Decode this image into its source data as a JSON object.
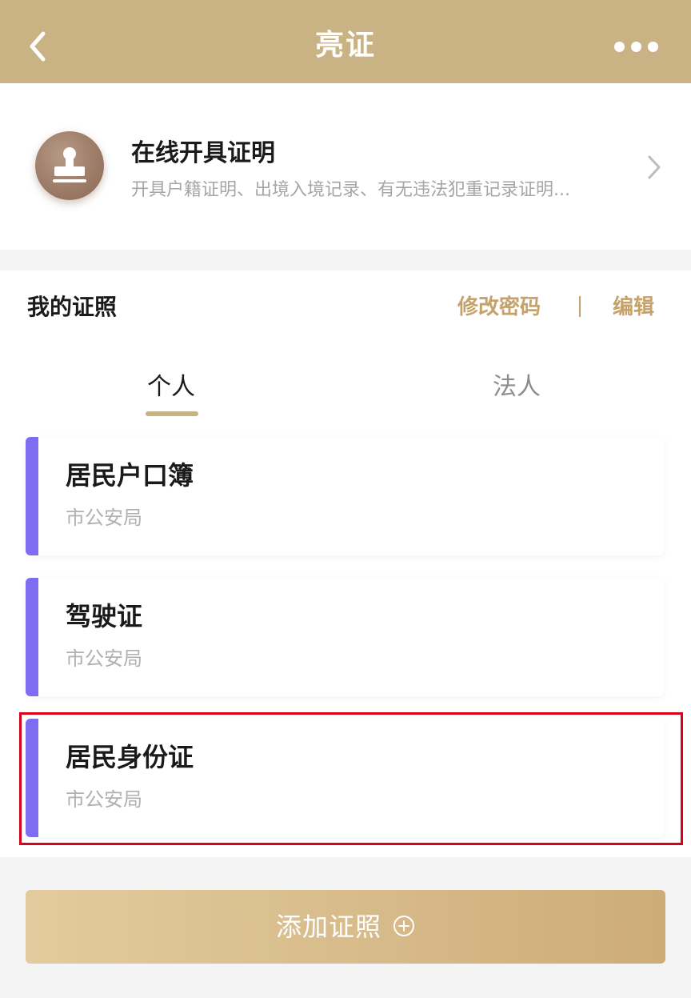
{
  "header": {
    "title": "亮证"
  },
  "service": {
    "title": "在线开具证明",
    "description": "开具户籍证明、出境入境记录、有无违法犯重记录证明..."
  },
  "certificates": {
    "section_title": "我的证照",
    "change_password": "修改密码",
    "edit": "编辑",
    "tabs": [
      {
        "label": "个人",
        "active": true
      },
      {
        "label": "法人",
        "active": false
      }
    ],
    "items": [
      {
        "title": "居民户口簿",
        "issuer": "市公安局"
      },
      {
        "title": "驾驶证",
        "issuer": "市公安局"
      },
      {
        "title": "居民身份证",
        "issuer": "市公安局",
        "highlighted": true
      }
    ],
    "accent_color": "#7f6cf2"
  },
  "add_button": {
    "label": "添加证照",
    "icon": "plus-circle-icon"
  },
  "theme": {
    "header_color": "#c9b283",
    "link_color": "#c4a26a",
    "highlight_color": "#d9001b"
  }
}
